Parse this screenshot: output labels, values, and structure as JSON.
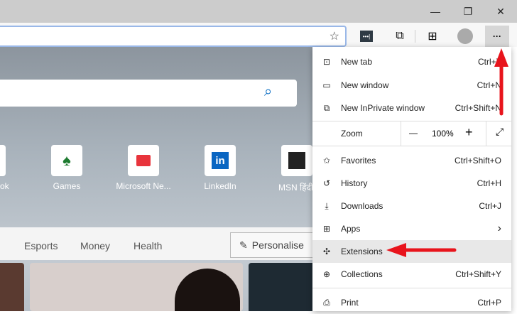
{
  "window": {
    "minimize": "minimize",
    "restore": "restore",
    "close": "close"
  },
  "toolbar": {
    "more_label": "···"
  },
  "tiles": [
    {
      "label": "ok"
    },
    {
      "label": "Games"
    },
    {
      "label": "Microsoft Ne..."
    },
    {
      "label": "LinkedIn"
    },
    {
      "label": "MSN हिंदी"
    }
  ],
  "news_tabs": [
    "Esports",
    "Money",
    "Health"
  ],
  "personalise": "Personalise",
  "menu": {
    "new_tab": {
      "label": "New tab",
      "shortcut": "Ctrl+T"
    },
    "new_window": {
      "label": "New window",
      "shortcut": "Ctrl+N"
    },
    "inprivate": {
      "label": "New InPrivate window",
      "shortcut": "Ctrl+Shift+N"
    },
    "zoom": {
      "label": "Zoom",
      "value": "100%",
      "minus": "—",
      "plus": "+"
    },
    "favorites": {
      "label": "Favorites",
      "shortcut": "Ctrl+Shift+O"
    },
    "history": {
      "label": "History",
      "shortcut": "Ctrl+H"
    },
    "downloads": {
      "label": "Downloads",
      "shortcut": "Ctrl+J"
    },
    "apps": {
      "label": "Apps",
      "shortcut": "›"
    },
    "extensions": {
      "label": "Extensions",
      "shortcut": ""
    },
    "collections": {
      "label": "Collections",
      "shortcut": "Ctrl+Shift+Y"
    },
    "print": {
      "label": "Print",
      "shortcut": "Ctrl+P"
    }
  },
  "colors": {
    "arrow": "#e8141c",
    "accent": "#0067c0"
  }
}
